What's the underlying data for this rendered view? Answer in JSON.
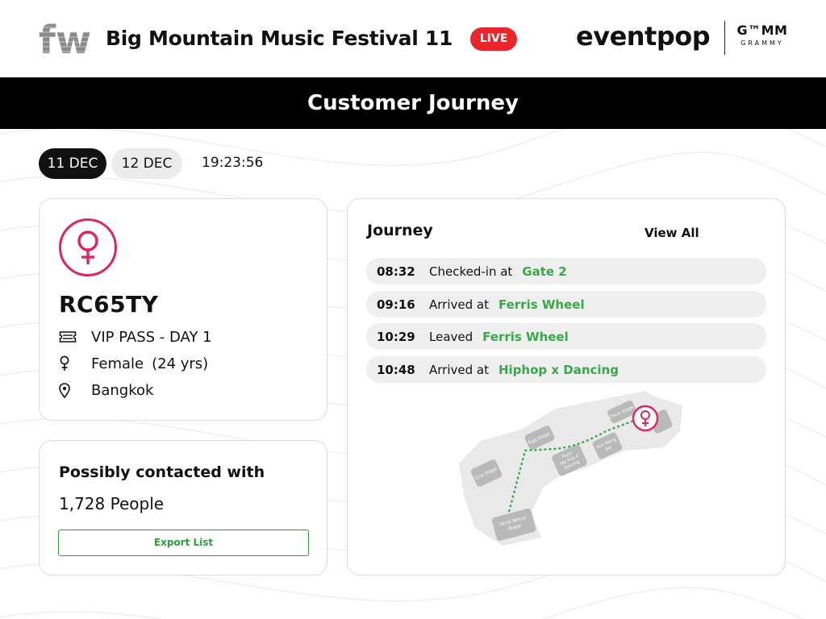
{
  "header": {
    "logo_text": "fw",
    "event_title": "Big Mountain Music Festival 11",
    "live_label": "LIVE",
    "brand_eventpop": "eventpop",
    "brand_gmm": "G™MM",
    "brand_gmm_sub": "GRAMMY"
  },
  "banner": {
    "title": "Customer Journey"
  },
  "dates": {
    "tabs": [
      "11 DEC",
      "12 DEC"
    ],
    "active": "11 DEC",
    "clock": "19:23:56"
  },
  "profile": {
    "id": "RC65TY",
    "ticket": "VIP PASS - DAY 1",
    "gender": "Female",
    "age": "(24 yrs)",
    "location": "Bangkok"
  },
  "contact": {
    "title": "Possibly contacted with",
    "count": "1,728 People",
    "export_label": "Export List"
  },
  "journey": {
    "title": "Journey",
    "view_all": "View All",
    "entries": [
      {
        "time": "08:32",
        "action": "Checked-in at",
        "place": "Gate 2"
      },
      {
        "time": "09:16",
        "action": "Arrived at",
        "place": "Ferris Wheel"
      },
      {
        "time": "10:29",
        "action": "Leaved",
        "place": "Ferris Wheel"
      },
      {
        "time": "10:48",
        "action": "Arrived at",
        "place": "Hiphop x Dancing"
      }
    ]
  },
  "map": {
    "labels": {
      "cow": "Cow Stage",
      "egg": "Egg Stage",
      "pepsi1": "Pepsi",
      "pepsi2": "Hip Hop X",
      "pepsi3": "Dancing",
      "run1": "Run Wang",
      "run2": "Bar",
      "chick": "Chick Stage",
      "ferris1": "Ferris Wheel",
      "ferris2": "Stage"
    },
    "route_color": "#3aa84a",
    "marker_color": "#e0245e"
  },
  "colors": {
    "accent_pink": "#e0245e",
    "accent_green": "#3aa84a",
    "live_red": "#e8262c"
  }
}
